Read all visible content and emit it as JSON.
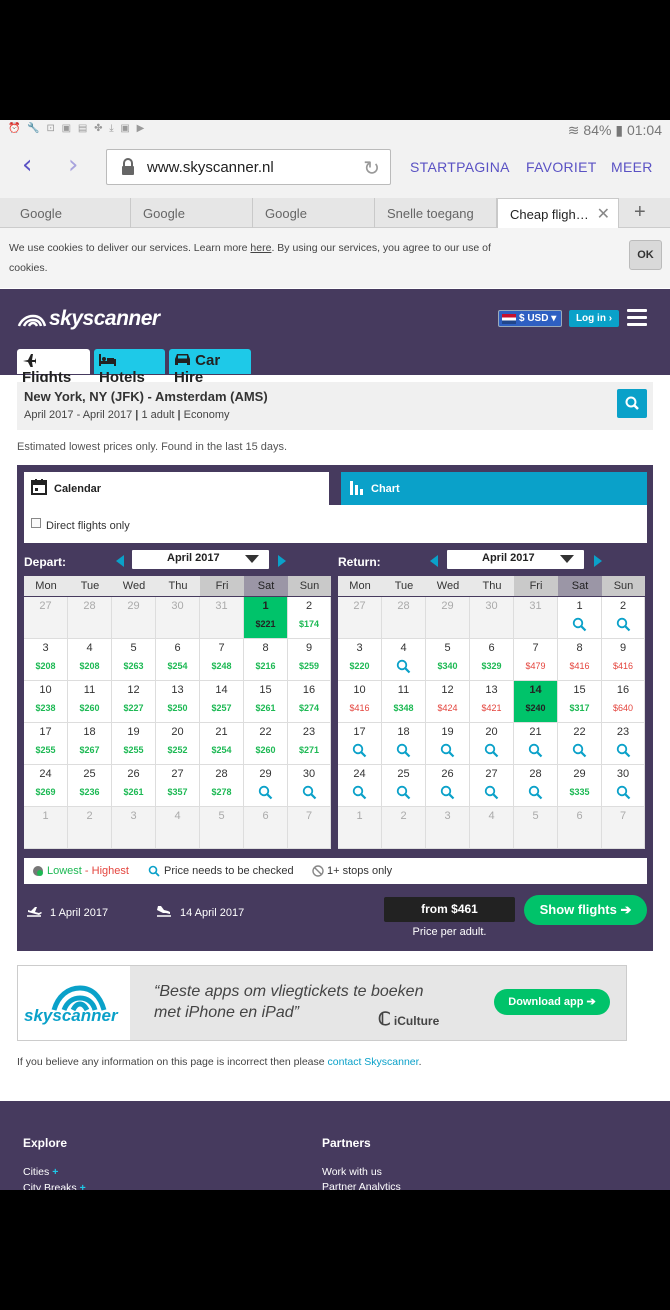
{
  "status_bar": {
    "icons": "⏰ 🔧 ⊡ ▣ ▤ ✤ ⤓ ▣ ▶",
    "battery": "84%",
    "time": "01:04"
  },
  "browser": {
    "url": "www.skyscanner.nl",
    "menu": [
      "STARTPAGINA",
      "FAVORIET",
      "MEER"
    ],
    "tabs": [
      "Google",
      "Google",
      "Google",
      "Snelle toegang",
      "Cheap fligh…"
    ],
    "new_tab": "+"
  },
  "cookie": {
    "text_before": "We use cookies to deliver our services. Learn more ",
    "link": "here",
    "text_after": ". By using our services, you agree to our use of cookies.",
    "ok": "OK"
  },
  "header": {
    "logo": "skyscanner",
    "currency": "$ USD",
    "login": "Log in",
    "nav": [
      {
        "label": "Flights",
        "icon": "plane-icon"
      },
      {
        "label": "Hotels",
        "icon": "bed-icon"
      },
      {
        "label": "Car Hire",
        "icon": "car-icon"
      }
    ]
  },
  "route": {
    "title": "New York, NY (JFK) - Amsterdam (AMS)",
    "dates": "April 2017 - April 2017",
    "adults": "1 adult",
    "cabin": "Economy"
  },
  "estimate_note": "Estimated lowest prices only. Found in the last 15 days.",
  "view_tabs": {
    "calendar": "Calendar",
    "chart": "Chart"
  },
  "direct_only": "Direct flights only",
  "weekdays": [
    "Mon",
    "Tue",
    "Wed",
    "Thu",
    "Fri",
    "Sat",
    "Sun"
  ],
  "depart": {
    "label": "Depart:",
    "month": "April 2017",
    "weeks": [
      [
        {
          "d": "27",
          "o": 1
        },
        {
          "d": "28",
          "o": 1
        },
        {
          "d": "29",
          "o": 1
        },
        {
          "d": "30",
          "o": 1
        },
        {
          "d": "31",
          "o": 1
        },
        {
          "d": "1",
          "p": "$221",
          "hl": 1
        },
        {
          "d": "2",
          "p": "$174"
        }
      ],
      [
        {
          "d": "3",
          "p": "$208"
        },
        {
          "d": "4",
          "p": "$208"
        },
        {
          "d": "5",
          "p": "$263"
        },
        {
          "d": "6",
          "p": "$254"
        },
        {
          "d": "7",
          "p": "$248"
        },
        {
          "d": "8",
          "p": "$216"
        },
        {
          "d": "9",
          "p": "$259"
        }
      ],
      [
        {
          "d": "10",
          "p": "$238"
        },
        {
          "d": "11",
          "p": "$260"
        },
        {
          "d": "12",
          "p": "$227"
        },
        {
          "d": "13",
          "p": "$250"
        },
        {
          "d": "14",
          "p": "$257"
        },
        {
          "d": "15",
          "p": "$261"
        },
        {
          "d": "16",
          "p": "$274"
        }
      ],
      [
        {
          "d": "17",
          "p": "$255"
        },
        {
          "d": "18",
          "p": "$267"
        },
        {
          "d": "19",
          "p": "$255"
        },
        {
          "d": "20",
          "p": "$252"
        },
        {
          "d": "21",
          "p": "$254"
        },
        {
          "d": "22",
          "p": "$260"
        },
        {
          "d": "23",
          "p": "$271"
        }
      ],
      [
        {
          "d": "24",
          "p": "$269"
        },
        {
          "d": "25",
          "p": "$236"
        },
        {
          "d": "26",
          "p": "$261"
        },
        {
          "d": "27",
          "p": "$357"
        },
        {
          "d": "28",
          "p": "$278"
        },
        {
          "d": "29",
          "s": 1
        },
        {
          "d": "30",
          "s": 1
        }
      ],
      [
        {
          "d": "1",
          "o": 1
        },
        {
          "d": "2",
          "o": 1
        },
        {
          "d": "3",
          "o": 1
        },
        {
          "d": "4",
          "o": 1
        },
        {
          "d": "5",
          "o": 1
        },
        {
          "d": "6",
          "o": 1
        },
        {
          "d": "7",
          "o": 1
        }
      ]
    ]
  },
  "return": {
    "label": "Return:",
    "month": "April 2017",
    "weeks": [
      [
        {
          "d": "27",
          "o": 1
        },
        {
          "d": "28",
          "o": 1
        },
        {
          "d": "29",
          "o": 1
        },
        {
          "d": "30",
          "o": 1
        },
        {
          "d": "31",
          "o": 1
        },
        {
          "d": "1",
          "s": 1
        },
        {
          "d": "2",
          "s": 1
        }
      ],
      [
        {
          "d": "3",
          "p": "$220"
        },
        {
          "d": "4",
          "s": 1
        },
        {
          "d": "5",
          "p": "$340"
        },
        {
          "d": "6",
          "p": "$329"
        },
        {
          "d": "7",
          "p": "$479",
          "r": 1
        },
        {
          "d": "8",
          "p": "$416",
          "r": 1
        },
        {
          "d": "9",
          "p": "$416",
          "r": 1
        }
      ],
      [
        {
          "d": "10",
          "p": "$416",
          "r": 1
        },
        {
          "d": "11",
          "p": "$348"
        },
        {
          "d": "12",
          "p": "$424",
          "r": 1
        },
        {
          "d": "13",
          "p": "$421",
          "r": 1
        },
        {
          "d": "14",
          "p": "$240",
          "hl": 1
        },
        {
          "d": "15",
          "p": "$317"
        },
        {
          "d": "16",
          "p": "$640",
          "r": 1
        }
      ],
      [
        {
          "d": "17",
          "s": 1
        },
        {
          "d": "18",
          "s": 1
        },
        {
          "d": "19",
          "s": 1
        },
        {
          "d": "20",
          "s": 1
        },
        {
          "d": "21",
          "s": 1
        },
        {
          "d": "22",
          "s": 1
        },
        {
          "d": "23",
          "s": 1
        }
      ],
      [
        {
          "d": "24",
          "s": 1
        },
        {
          "d": "25",
          "s": 1
        },
        {
          "d": "26",
          "s": 1
        },
        {
          "d": "27",
          "s": 1
        },
        {
          "d": "28",
          "s": 1
        },
        {
          "d": "29",
          "p": "$335"
        },
        {
          "d": "30",
          "s": 1
        }
      ],
      [
        {
          "d": "1",
          "o": 1
        },
        {
          "d": "2",
          "o": 1
        },
        {
          "d": "3",
          "o": 1
        },
        {
          "d": "4",
          "o": 1
        },
        {
          "d": "5",
          "o": 1
        },
        {
          "d": "6",
          "o": 1
        },
        {
          "d": "7",
          "o": 1
        }
      ]
    ]
  },
  "legend": {
    "lowest": "Lowest",
    "sep": " - ",
    "highest": "Highest",
    "check": "Price needs to be checked",
    "stops": "1+ stops only"
  },
  "summary": {
    "depart_date": "1 April 2017",
    "return_date": "14 April 2017",
    "from_price": "from $461",
    "per_adult": "Price per adult.",
    "show_flights": "Show flights"
  },
  "ad": {
    "quote_line1": "“Beste apps om vliegtickets te boeken",
    "quote_line2": "met iPhone en iPad”",
    "source": "iCulture",
    "button": "Download app",
    "logo": "skyscanner"
  },
  "incorrect": {
    "text": "If you believe any information on this page is incorrect then please ",
    "link": "contact Skyscanner",
    "end": "."
  },
  "footer": {
    "explore": "Explore",
    "explore_items": [
      "Cities",
      "City Breaks"
    ],
    "partners": "Partners",
    "partner_items": [
      "Work with us",
      "Partner Analytics"
    ]
  },
  "colors": {
    "purple": "#463a5e",
    "teal": "#0aa1c9",
    "green": "#00c36a",
    "red": "#e4443d"
  }
}
